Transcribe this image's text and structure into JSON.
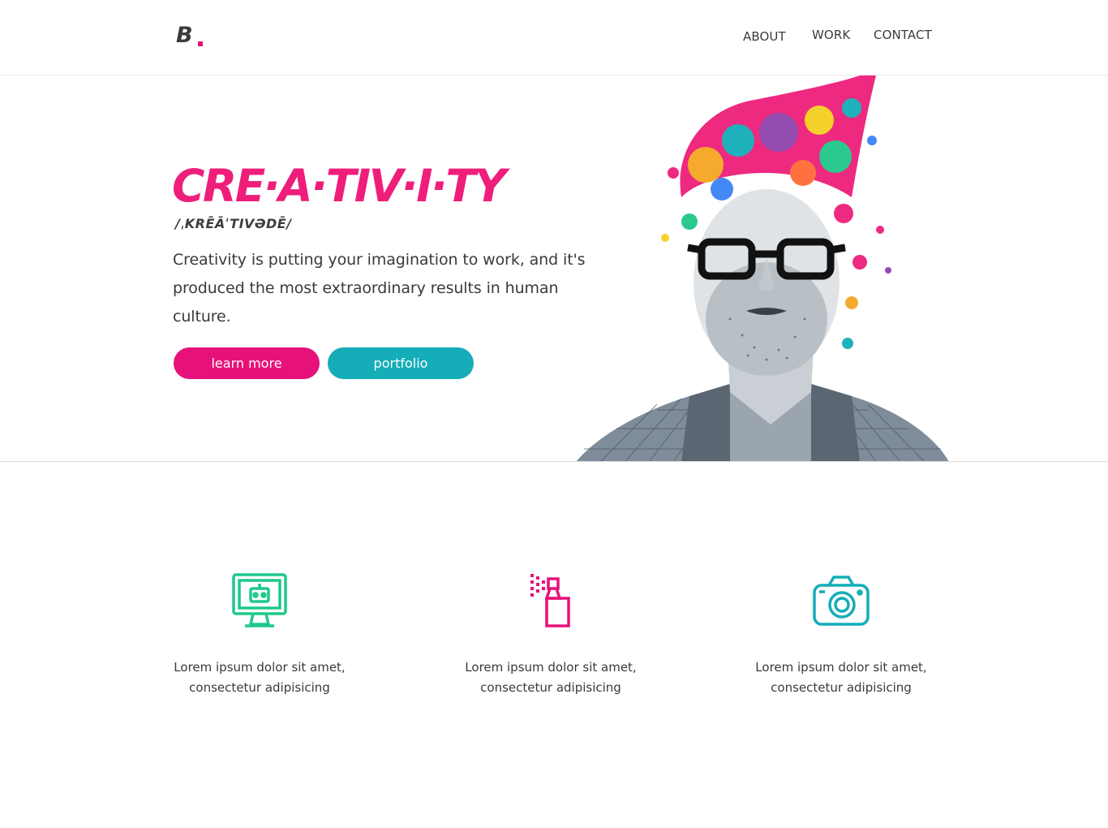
{
  "header": {
    "logo_text": "B",
    "nav": {
      "about": "ABOUT",
      "work": "WORK",
      "contact": "CONTACT"
    }
  },
  "hero": {
    "title": "CRE·A·TIV·I·TY",
    "phonetic": "/ˌKRĒĀˈTIVƏDĒ/",
    "description": "Creativity is putting your imagination to work, and it's produced the most extraordinary results in human culture.",
    "buttons": {
      "learn_more": "learn more",
      "portfolio": "portfolio"
    }
  },
  "features": [
    {
      "icon": "computer-monitor-icon",
      "text": "Lorem ipsum dolor sit amet, consectetur adipisicing"
    },
    {
      "icon": "spray-bottle-icon",
      "text": "Lorem ipsum dolor sit amet, consectetur adipisicing"
    },
    {
      "icon": "camera-icon",
      "text": "Lorem ipsum dolor sit amet, consectetur adipisicing"
    }
  ],
  "colors": {
    "accent_pink": "#ee1e7a",
    "accent_teal": "#14adb8",
    "icon_green": "#1fc88a"
  }
}
